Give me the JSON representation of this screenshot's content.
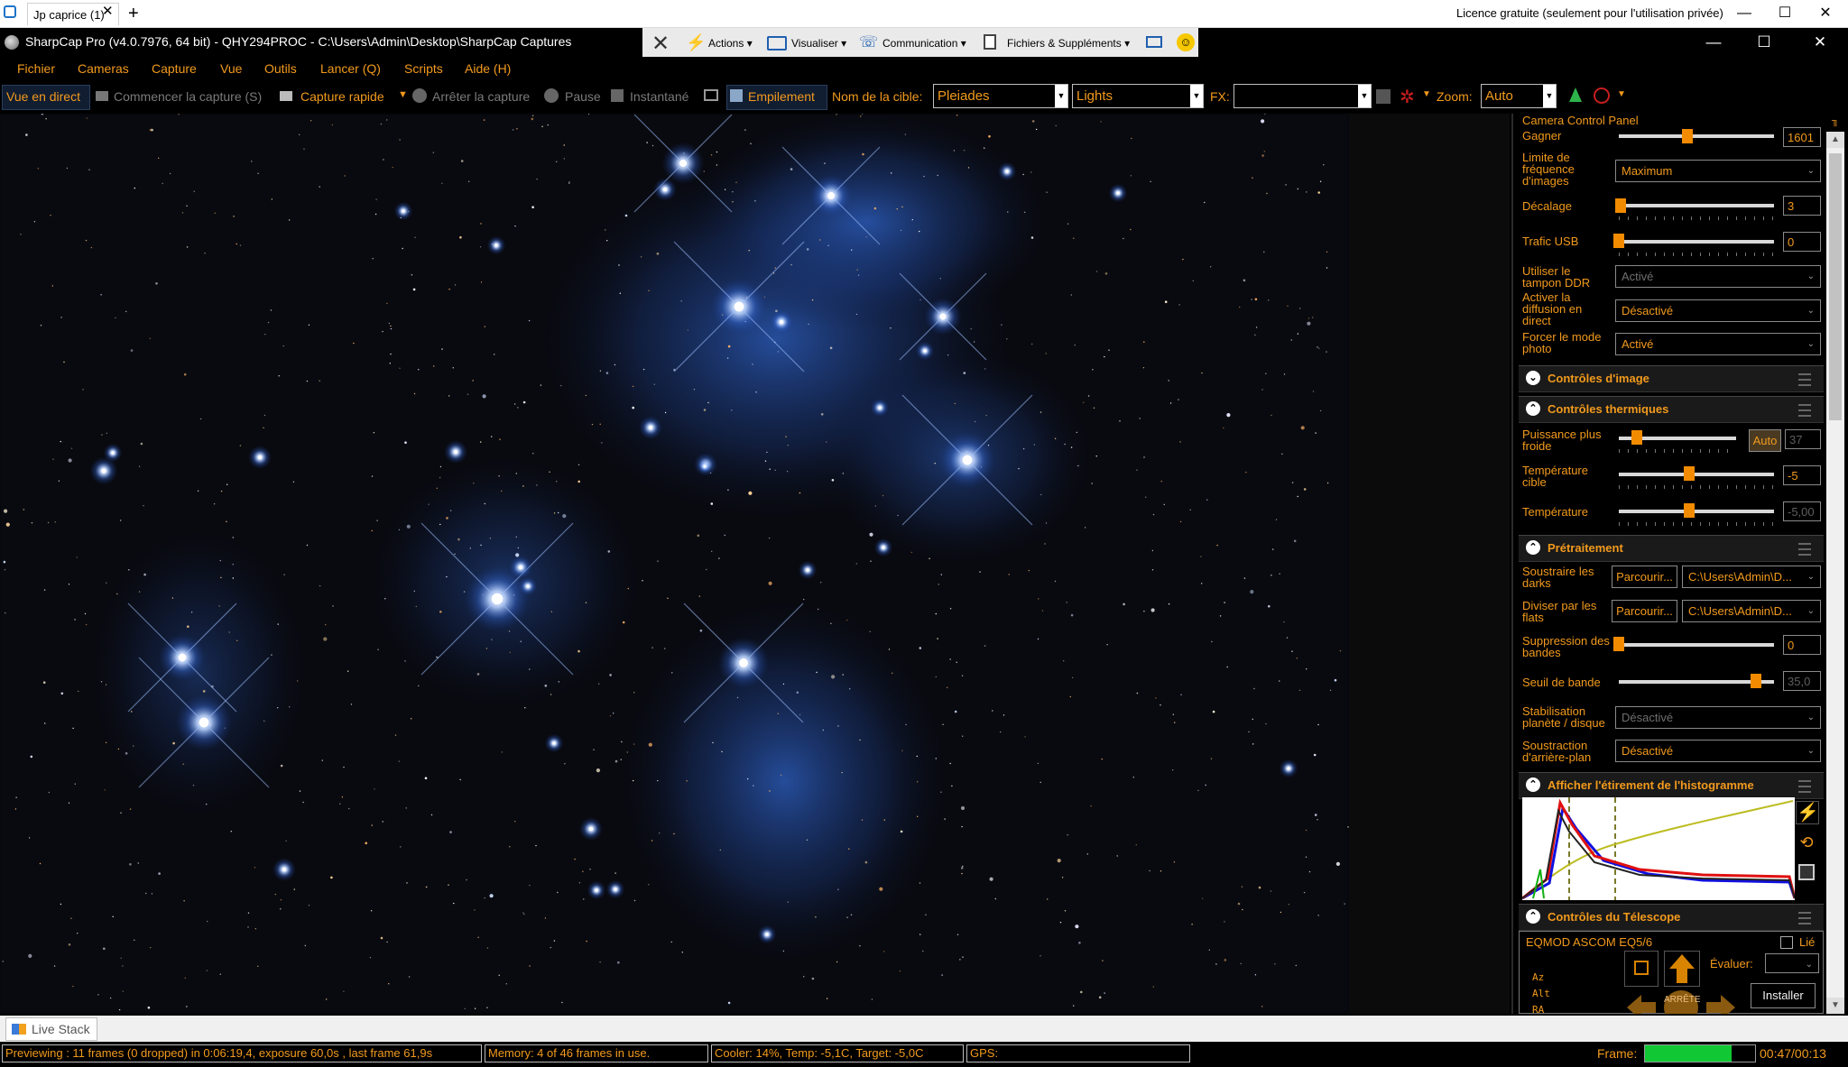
{
  "browser": {
    "tab_title": "Jp caprice (1)",
    "tab_close": "✕",
    "new_tab": "+",
    "license": "Licence gratuite (seulement pour l'utilisation privée)",
    "min": "—",
    "max": "☐",
    "close": "✕"
  },
  "app": {
    "title": "SharpCap Pro (v4.0.7976, 64 bit) - QHY294PROC - C:\\Users\\Admin\\Desktop\\SharpCap Captures"
  },
  "remote_toolbar": {
    "actions": "Actions",
    "view": "Visualiser",
    "comm": "Communication",
    "files": "Fichiers & Suppléments"
  },
  "menu": [
    "Fichier",
    "Cameras",
    "Capture",
    "Vue",
    "Outils",
    "Lancer (Q)",
    "Scripts",
    "Aide (H)"
  ],
  "toolbar": {
    "live_view": "Vue en direct",
    "start_capture": "Commencer la capture (S)",
    "quick_capture": "Capture rapide",
    "stop_capture": "Arrêter la capture",
    "pause": "Pause",
    "snapshot": "Instantané",
    "stacking": "Empilement",
    "target_label": "Nom de la cible:",
    "target_value": "Pleiades",
    "frame_type": "Lights",
    "fx_label": "FX:",
    "fx_value": "",
    "zoom_label": "Zoom:",
    "zoom_value": "Auto"
  },
  "panel": {
    "header": "Camera Control Panel",
    "gain_label": "Gagner",
    "gain_value": "1601",
    "fps_label": "Limite de fréquence d'images",
    "fps_value": "Maximum",
    "offset_label": "Décalage",
    "offset_value": "3",
    "usb_label": "Trafic USB",
    "usb_value": "0",
    "ddr_label": "Utiliser le tampon DDR",
    "ddr_value": "Activé",
    "stream_label": "Activer la diffusion en direct",
    "stream_value": "Désactivé",
    "photo_label": "Forcer le mode photo",
    "photo_value": "Activé",
    "sec_image": "Contrôles d'image",
    "sec_thermal": "Contrôles thermiques",
    "cooler_label": "Puissance plus froide",
    "cooler_auto": "Auto",
    "cooler_value": "37",
    "target_temp_label": "Température cible",
    "target_temp_value": "-5",
    "temp_label": "Température",
    "temp_value": "-5,00",
    "sec_pre": "Prétraitement",
    "darks_label": "Soustraire les darks",
    "browse": "Parcourir...",
    "darks_path": "C:\\Users\\Admin\\D...",
    "flats_label": "Diviser par les flats",
    "flats_path": "C:\\Users\\Admin\\D...",
    "banding_label": "Suppression des bandes",
    "banding_value": "0",
    "band_thr_label": "Seuil de bande",
    "band_thr_value": "35,0",
    "planet_label": "Stabilisation planète / disque",
    "planet_value": "Désactivé",
    "bg_label": "Soustraction d'arrière-plan",
    "bg_value": "Désactivé",
    "sec_hist": "Afficher l'étirement de l'histogramme",
    "sec_scope": "Contrôles du Télescope",
    "mount": "EQMOD ASCOM EQ5/6",
    "linked": "Lié",
    "rate_label": "Évaluer:",
    "install": "Installer",
    "coord_az": "Az",
    "coord_alt": "Alt",
    "coord_ra": "RA",
    "stop_btn": "ARRÊTE"
  },
  "bottom": {
    "live_stack": "Live Stack"
  },
  "status": {
    "preview": "Previewing : 11 frames (0 dropped) in 0:06:19,4, exposure 60,0s , last frame 61,9s",
    "memory": "Memory: 4 of 46 frames in use.",
    "cooler": "Cooler: 14%, Temp: -5,1C, Target: -5,0C",
    "gps": "GPS:",
    "frame_label": "Frame:",
    "frame_time": "00:47/00:13",
    "frame_progress": 0.79
  },
  "colors": {
    "accent": "#f29a1d",
    "progress": "#11c733",
    "slider": "#f28b00"
  }
}
